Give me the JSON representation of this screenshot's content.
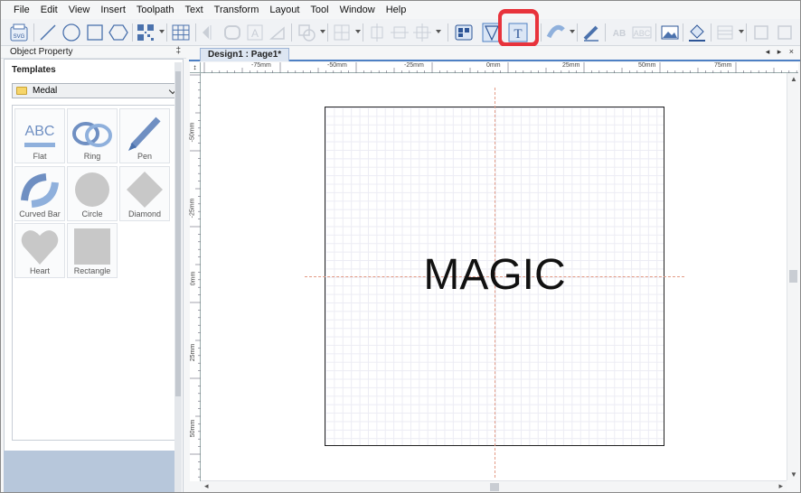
{
  "menu": [
    "File",
    "Edit",
    "View",
    "Insert",
    "Toolpath",
    "Text",
    "Transform",
    "Layout",
    "Tool",
    "Window",
    "Help"
  ],
  "toolbar": {
    "svg_button_label": "SVG",
    "text_tool_glyph": "T",
    "text_tool_highlighted": true
  },
  "panel": {
    "header": "Object Property",
    "pin_glyph": "‡",
    "templates_title": "Templates",
    "category_value": "Medal",
    "items": [
      {
        "label": "Flat",
        "icon": "flat-abc-icon"
      },
      {
        "label": "Ring",
        "icon": "ring-abc-icon"
      },
      {
        "label": "Pen",
        "icon": "pen-abc-icon"
      },
      {
        "label": "Curved Bar",
        "icon": "curved-bar-abc-icon"
      },
      {
        "label": "Circle",
        "icon": "circle-shape-icon"
      },
      {
        "label": "Diamond",
        "icon": "diamond-shape-icon"
      },
      {
        "label": "Heart",
        "icon": "heart-shape-icon"
      },
      {
        "label": "Rectangle",
        "icon": "rectangle-shape-icon"
      }
    ],
    "icon_text": "ABC"
  },
  "document": {
    "tab_label": "Design1 : Page1*",
    "tab_controls": "◂ ▸ ×",
    "canvas_text": "MAGIC",
    "ruler_unit": "mm",
    "ruler_corner_glyph": "↕",
    "ruler_top_labels": [
      "-75mm",
      "-50mm",
      "-25mm",
      "0mm",
      "25mm",
      "50mm",
      "75mm"
    ],
    "ruler_left_labels": [
      "-50mm",
      "-25mm",
      "0mm",
      "25mm",
      "50mm"
    ]
  },
  "colors": {
    "highlight": "#e8333c",
    "accent": "#4e80c4",
    "guide": "#e39a85"
  }
}
